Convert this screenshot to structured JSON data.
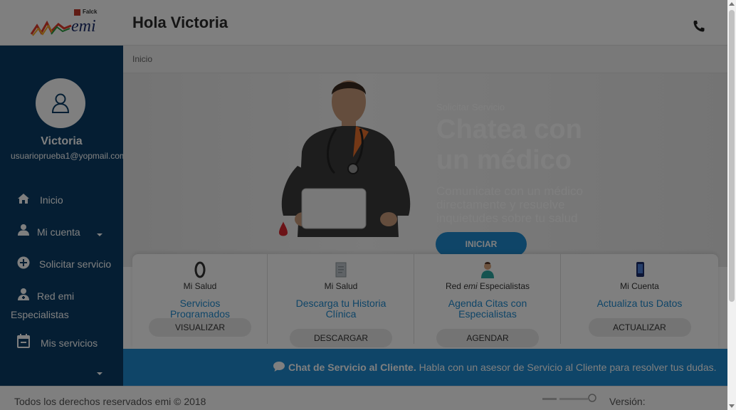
{
  "header": {
    "logo_brand": "emi",
    "logo_parent": "Falck",
    "greeting": "Hola Victoria",
    "phone_icon": "phone-icon"
  },
  "sidebar": {
    "user_name": "Victoria",
    "user_email": "usuarioprueba1@yopmail.com",
    "items": [
      {
        "label": "Inicio",
        "icon": "home-icon"
      },
      {
        "label": "Mi cuenta",
        "icon": "user-icon"
      },
      {
        "label": "Solicitar servicio",
        "icon": "plus-circle-icon"
      },
      {
        "label": "Red emi",
        "label2": "Especialistas",
        "icon": "doctor-icon"
      },
      {
        "label": "Mis servicios",
        "icon": "calendar-icon"
      }
    ]
  },
  "breadcrumb": "Inicio",
  "hero": {
    "kicker": "Solicitar Servicio",
    "title": "Chatea con un médico",
    "description": "Comunicate con un médico directamente y resuelve inquietudes sobre tu salud",
    "button": "INICIAR"
  },
  "cards": [
    {
      "category": "Mi Salud",
      "title": "Servicios Programados",
      "button": "VISUALIZAR",
      "icon": "bracelet-icon"
    },
    {
      "category": "Mi Salud",
      "title": "Descarga tu Historia Clínica",
      "button": "DESCARGAR",
      "icon": "document-icon"
    },
    {
      "category_pre": "Red ",
      "category_em": "emi",
      "category_post": " Especialistas",
      "title": "Agenda Citas con Especialistas",
      "button": "AGENDAR",
      "icon": "nurse-icon"
    },
    {
      "category": "Mi Cuenta",
      "title": "Actualiza tus Datos",
      "button": "ACTUALIZAR",
      "icon": "phone-device-icon"
    }
  ],
  "chat_bar": {
    "bold": "Chat de Servicio al Cliente.",
    "text": " Habla con un asesor de Servicio al Cliente para resolver tus dudas."
  },
  "footer": {
    "copyright": "Todos los derechos reservados emi © 2018",
    "version": "Versión:"
  },
  "colors": {
    "sidebar": "#0a3d66",
    "accent": "#1e8bd0",
    "overlay": "rgba(0,0,0,0.5)"
  }
}
